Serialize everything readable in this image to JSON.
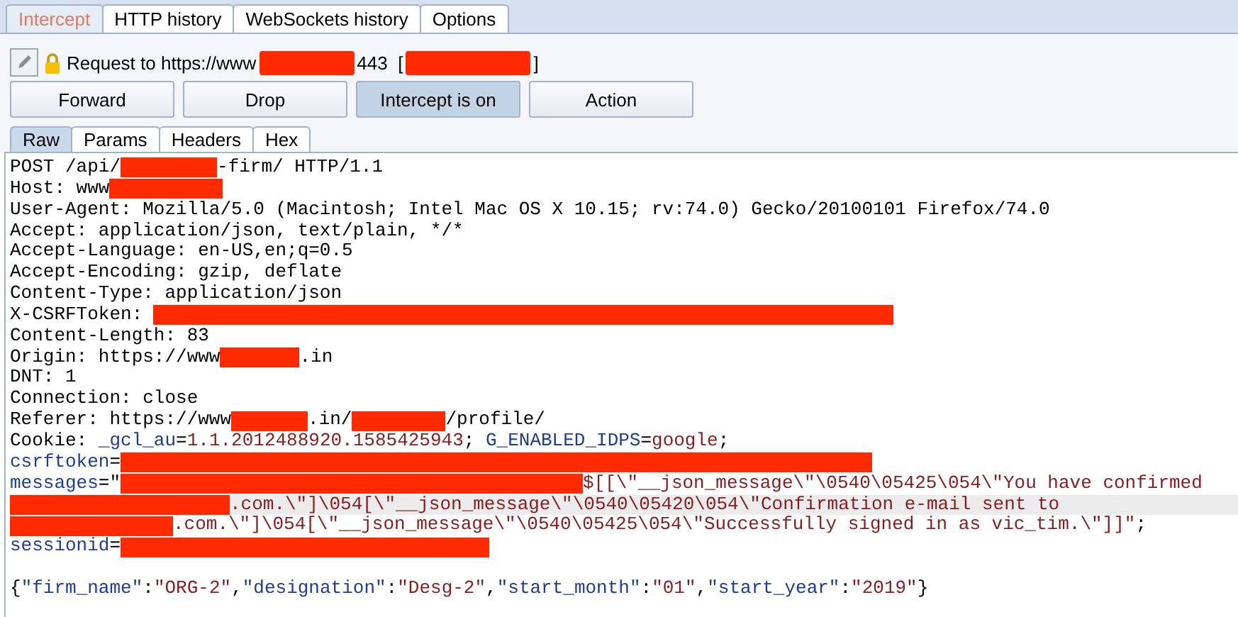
{
  "main_tabs": [
    {
      "label": "Intercept",
      "selected": true
    },
    {
      "label": "HTTP history",
      "selected": false
    },
    {
      "label": "WebSockets history",
      "selected": false
    },
    {
      "label": "Options",
      "selected": false
    }
  ],
  "request_info": [
    {
      "kind": "plain",
      "text": "Request to https://www"
    },
    {
      "kind": "redaction"
    },
    {
      "kind": "plain",
      "text": "443  ["
    },
    {
      "kind": "redaction"
    },
    {
      "kind": "plain",
      "text": "]"
    }
  ],
  "buttons": [
    {
      "label": "Forward",
      "pressed": false
    },
    {
      "label": "Drop",
      "pressed": false
    },
    {
      "label": "Intercept is on",
      "pressed": true
    },
    {
      "label": "Action",
      "pressed": false
    }
  ],
  "view_tabs": [
    {
      "label": "Raw",
      "selected": true
    },
    {
      "label": "Params",
      "selected": false
    },
    {
      "label": "Headers",
      "selected": false
    },
    {
      "label": "Hex",
      "selected": false
    }
  ],
  "lines": [
    {
      "highlighted": false,
      "segments": [
        {
          "kind": "plain",
          "text": "POST /api/"
        },
        {
          "kind": "redaction"
        },
        {
          "kind": "plain",
          "text": "-firm/ HTTP/1.1"
        }
      ]
    },
    {
      "highlighted": false,
      "segments": [
        {
          "kind": "plain",
          "text": "Host: www"
        },
        {
          "kind": "redaction"
        }
      ]
    },
    {
      "highlighted": false,
      "segments": [
        {
          "kind": "plain",
          "text": "User-Agent: Mozilla/5.0 (Macintosh; Intel Mac OS X 10.15; rv:74.0) Gecko/20100101 Firefox/74.0"
        }
      ]
    },
    {
      "highlighted": false,
      "segments": [
        {
          "kind": "plain",
          "text": "Accept: application/json, text/plain, */*"
        }
      ]
    },
    {
      "highlighted": false,
      "segments": [
        {
          "kind": "plain",
          "text": "Accept-Language: en-US,en;q=0.5"
        }
      ]
    },
    {
      "highlighted": false,
      "segments": [
        {
          "kind": "plain",
          "text": "Accept-Encoding: gzip, deflate"
        }
      ]
    },
    {
      "highlighted": false,
      "segments": [
        {
          "kind": "plain",
          "text": "Content-Type: application/json"
        }
      ]
    },
    {
      "highlighted": false,
      "segments": [
        {
          "kind": "plain",
          "text": "X-CSRFToken: "
        },
        {
          "kind": "redaction"
        }
      ]
    },
    {
      "highlighted": false,
      "segments": [
        {
          "kind": "plain",
          "text": "Content-Length: 83"
        }
      ]
    },
    {
      "highlighted": false,
      "segments": [
        {
          "kind": "plain",
          "text": "Origin: https://www"
        },
        {
          "kind": "redaction"
        },
        {
          "kind": "plain",
          "text": ".in"
        }
      ]
    },
    {
      "highlighted": false,
      "segments": [
        {
          "kind": "plain",
          "text": "DNT: 1"
        }
      ]
    },
    {
      "highlighted": false,
      "segments": [
        {
          "kind": "plain",
          "text": "Connection: close"
        }
      ]
    },
    {
      "highlighted": false,
      "segments": [
        {
          "kind": "plain",
          "text": "Referer: https://www"
        },
        {
          "kind": "redaction"
        },
        {
          "kind": "plain",
          "text": ".in/"
        },
        {
          "kind": "redaction"
        },
        {
          "kind": "plain",
          "text": "/profile/"
        }
      ]
    },
    {
      "highlighted": false,
      "segments": [
        {
          "kind": "plain",
          "text": "Cookie: "
        },
        {
          "kind": "name",
          "text": "_gcl_au"
        },
        {
          "kind": "plain",
          "text": "="
        },
        {
          "kind": "value",
          "text": "1.1.2012488920.1585425943"
        },
        {
          "kind": "plain",
          "text": "; "
        },
        {
          "kind": "name",
          "text": "G_ENABLED_IDPS"
        },
        {
          "kind": "plain",
          "text": "="
        },
        {
          "kind": "value",
          "text": "google"
        },
        {
          "kind": "plain",
          "text": ";"
        }
      ]
    },
    {
      "highlighted": false,
      "segments": [
        {
          "kind": "name",
          "text": "csrftoken"
        },
        {
          "kind": "plain",
          "text": "="
        },
        {
          "kind": "redaction"
        }
      ]
    },
    {
      "highlighted": false,
      "segments": [
        {
          "kind": "name",
          "text": "messages"
        },
        {
          "kind": "plain",
          "text": "=\""
        },
        {
          "kind": "redaction"
        },
        {
          "kind": "value",
          "text": "$[[\\\"__json_message\\\"\\0540\\05425\\054\\\"You have confirmed"
        }
      ]
    },
    {
      "highlighted": true,
      "segments": [
        {
          "kind": "redaction"
        },
        {
          "kind": "value",
          "text": ".com.\\\"]\\054[\\\"__json_message\\\"\\0540\\05420\\054\\\"Confirmation e-mail sent to"
        }
      ]
    },
    {
      "highlighted": false,
      "segments": [
        {
          "kind": "redaction"
        },
        {
          "kind": "value",
          "text": ".com.\\\"]\\054[\\\"__json_message\\\"\\0540\\05425\\054\\\"Successfully signed in as vic_tim.\\\"]]\""
        },
        {
          "kind": "plain",
          "text": ";"
        }
      ]
    },
    {
      "highlighted": false,
      "segments": [
        {
          "kind": "name",
          "text": "sessionid"
        },
        {
          "kind": "plain",
          "text": "="
        },
        {
          "kind": "redaction"
        }
      ]
    }
  ],
  "body": {
    "segments": [
      {
        "kind": "plain",
        "text": "{"
      },
      {
        "kind": "name",
        "text": "\"firm_name\""
      },
      {
        "kind": "plain",
        "text": ":"
      },
      {
        "kind": "value",
        "text": "\"ORG-2\""
      },
      {
        "kind": "plain",
        "text": ","
      },
      {
        "kind": "name",
        "text": "\"designation\""
      },
      {
        "kind": "plain",
        "text": ":"
      },
      {
        "kind": "value",
        "text": "\"Desg-2\""
      },
      {
        "kind": "plain",
        "text": ","
      },
      {
        "kind": "name",
        "text": "\"start_month\""
      },
      {
        "kind": "plain",
        "text": ":"
      },
      {
        "kind": "value",
        "text": "\"01\""
      },
      {
        "kind": "plain",
        "text": ","
      },
      {
        "kind": "name",
        "text": "\"start_year\""
      },
      {
        "kind": "plain",
        "text": ":"
      },
      {
        "kind": "value",
        "text": "\"2019\""
      },
      {
        "kind": "plain",
        "text": "}"
      }
    ]
  }
}
